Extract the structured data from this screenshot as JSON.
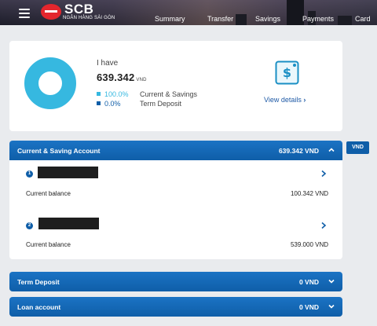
{
  "header": {
    "logo_text": "SCB",
    "logo_sub": "NGÂN HÀNG SÀI GÒN",
    "nav": [
      "Summary",
      "Transfer",
      "Savings",
      "Payments",
      "Card"
    ]
  },
  "summary": {
    "intro": "I have",
    "total": "639.342",
    "total_unit": "VND",
    "breakdown": [
      {
        "percent": "100.0%",
        "label": "Current & Savings",
        "color": "#36b8e0"
      },
      {
        "percent": "0.0%",
        "label": "Term Deposit",
        "color": "#0f5ea8"
      }
    ],
    "view_details": "View details",
    "icon": "dollar-document-icon"
  },
  "currency_badge": "VND",
  "current_saving": {
    "title": "Current & Saving Account",
    "total": "639.342 VND",
    "accounts": [
      {
        "index": "1",
        "balance_label": "Current balance",
        "balance": "100.342 VND"
      },
      {
        "index": "2",
        "balance_label": "Current balance",
        "balance": "539.000 VND"
      }
    ]
  },
  "term_deposit": {
    "title": "Term Deposit",
    "total": "0 VND"
  },
  "loan_account": {
    "title": "Loan account",
    "total": "0 VND"
  },
  "colors": {
    "primary": "#0f5ea8",
    "accent": "#36b8e0",
    "brand_red": "#e3262d"
  }
}
